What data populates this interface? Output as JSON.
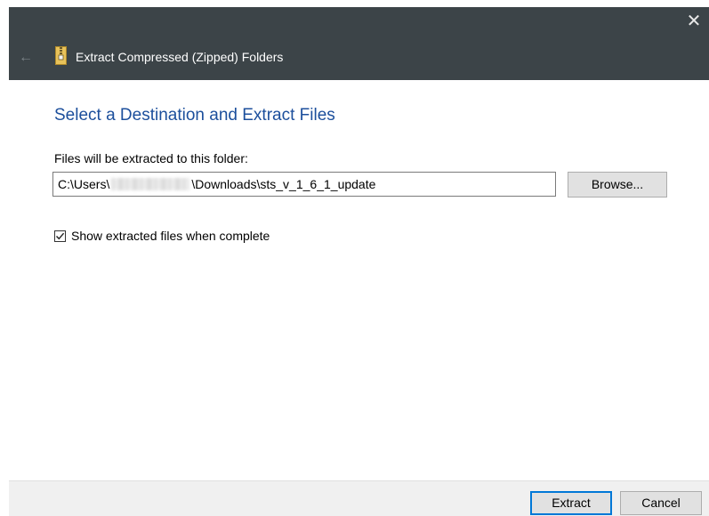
{
  "window": {
    "title": "Extract Compressed (Zipped) Folders",
    "close_glyph": "✕",
    "back_glyph": "←",
    "icon": "zip-folder-icon"
  },
  "main": {
    "heading": "Select a Destination and Extract Files",
    "folder_label": "Files will be extracted to this folder:",
    "path_prefix": "C:\\Users\\",
    "path_suffix": "\\Downloads\\sts_v_1_6_1_update",
    "path_redacted": true,
    "browse_label": "Browse...",
    "show_files_label": "Show extracted files when complete",
    "show_files_checked": true
  },
  "footer": {
    "extract_label": "Extract",
    "cancel_label": "Cancel"
  },
  "colors": {
    "titlebar": "#3c4448",
    "heading": "#1c4f9c",
    "default_button_border": "#0078d7",
    "footer": "#f0f0f0"
  }
}
